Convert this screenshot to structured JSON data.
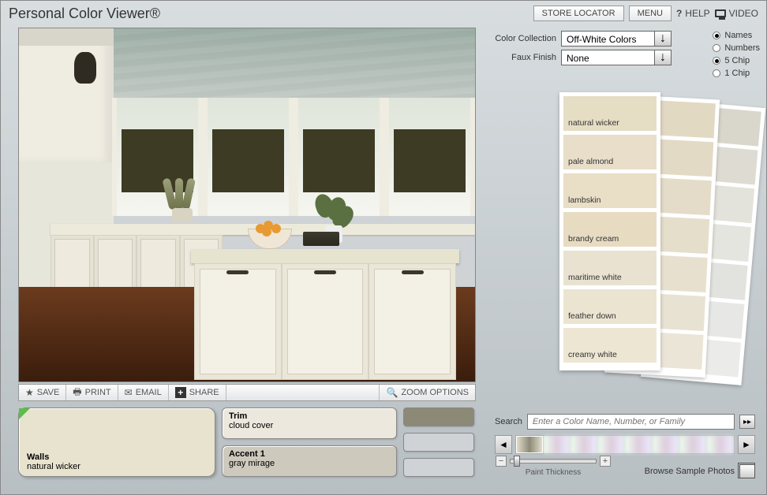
{
  "title": "Personal Color Viewer®",
  "topbar": {
    "store_locator": "STORE LOCATOR",
    "menu": "MENU",
    "help": "HELP",
    "video": "VIDEO"
  },
  "controls": {
    "collection_label": "Color Collection",
    "collection_value": "Off-White Colors",
    "faux_label": "Faux Finish",
    "faux_value": "None"
  },
  "radios": {
    "names": "Names",
    "numbers": "Numbers",
    "five_chip": "5 Chip",
    "one_chip": "1 Chip",
    "selected_label_mode": "names",
    "selected_chip_mode": "5"
  },
  "chips": {
    "strip1": [
      {
        "name": "natural wicker",
        "color": "#e6ddc5"
      },
      {
        "name": "pale almond",
        "color": "#e8dec9"
      },
      {
        "name": "lambskin",
        "color": "#e9dec6"
      },
      {
        "name": "brandy cream",
        "color": "#e7dbc2"
      },
      {
        "name": "maritime white",
        "color": "#e9e2d0"
      },
      {
        "name": "feather down",
        "color": "#ebe4d1"
      },
      {
        "name": "creamy white",
        "color": "#ece6d3"
      }
    ],
    "strip2": [
      {
        "color": "#e2d9c2"
      },
      {
        "color": "#e3dac5"
      },
      {
        "color": "#e4dcc8"
      },
      {
        "color": "#e5decb"
      },
      {
        "color": "#e7e0cf"
      },
      {
        "color": "#e8e2d3"
      },
      {
        "color": "#eae5d7"
      }
    ],
    "strip3": [
      {
        "color": "#d9d7cb"
      },
      {
        "color": "#dedcd2"
      },
      {
        "color": "#e3e2db"
      },
      {
        "color": "#e5e5df"
      },
      {
        "color": "#e2e3df"
      },
      {
        "color": "#e7e8e5"
      },
      {
        "color": "#ebece9"
      }
    ]
  },
  "toolbar": {
    "save": "SAVE",
    "print": "PRINT",
    "email": "EMAIL",
    "share": "SHARE",
    "zoom": "ZOOM OPTIONS"
  },
  "swatches": {
    "walls_label": "Walls",
    "walls_color_name": "natural wicker",
    "walls_color": "#e8e3ce",
    "trim_label": "Trim",
    "trim_color_name": "cloud cover",
    "trim_color": "#ece8de",
    "accent_label": "Accent 1",
    "accent_color_name": "gray mirage",
    "accent_color": "#cdcabd"
  },
  "search": {
    "label": "Search",
    "placeholder": "Enter a Color Name, Number, or Family"
  },
  "thickness_label": "Paint Thickness",
  "browse_label": "Browse Sample Photos"
}
